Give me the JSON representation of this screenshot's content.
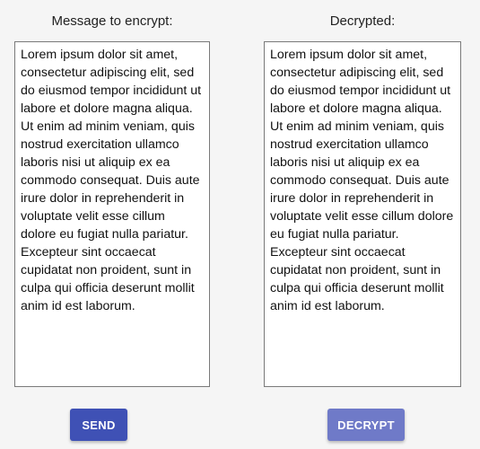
{
  "encrypt_panel": {
    "title": "Message to encrypt:",
    "text": "Lorem ipsum dolor sit amet, consectetur adipiscing elit, sed do eiusmod tempor incididunt ut labore et dolore magna aliqua. Ut enim ad minim veniam, quis nostrud exercitation ullamco laboris nisi ut aliquip ex ea commodo consequat. Duis aute irure dolor in reprehenderit in voluptate velit esse cillum dolore eu fugiat nulla pariatur. Excepteur sint occaecat cupidatat non proident, sunt in culpa qui officia deserunt mollit anim id est laborum."
  },
  "decrypt_panel": {
    "title": "Decrypted:",
    "text": "Lorem ipsum dolor sit amet, consectetur adipiscing elit, sed do eiusmod tempor incididunt ut labore et dolore magna aliqua. Ut enim ad minim veniam, quis nostrud exercitation ullamco laboris nisi ut aliquip ex ea commodo consequat. Duis aute irure dolor in reprehenderit in voluptate velit esse cillum dolore eu fugiat nulla pariatur. Excepteur sint occaecat cupidatat non proident, sunt in culpa qui officia deserunt mollit anim id est laborum."
  },
  "buttons": {
    "send_label": "SEND",
    "decrypt_label": "DECRYPT"
  },
  "colors": {
    "send_button": "#3f51b5",
    "decrypt_button": "#6f7ac8",
    "background": "#f5f5f5"
  }
}
